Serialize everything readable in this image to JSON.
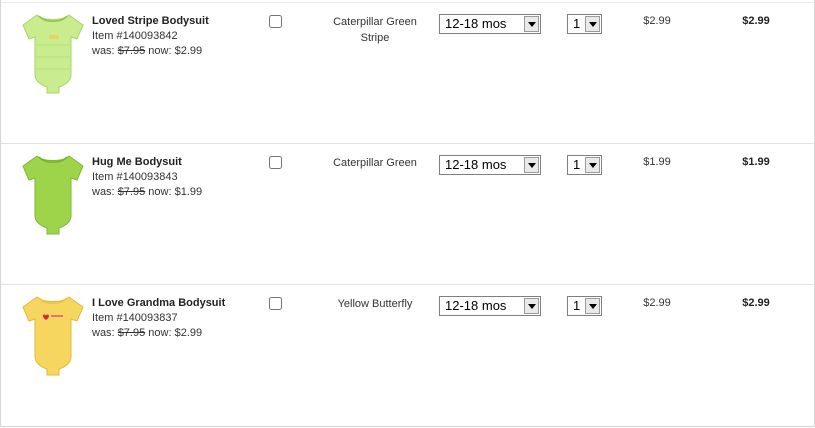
{
  "colors": {
    "green_light": "#c9ec8e",
    "green": "#9ed449",
    "yellow": "#f6d65e"
  },
  "items": [
    {
      "name": "Loved Stripe Bodysuit",
      "item_label": "Item #140093842",
      "was_label": "was:",
      "was_price": "$7.95",
      "now_label": "now:",
      "now_price": "$2.99",
      "color_line1": "Caterpillar Green",
      "color_line2": "Stripe",
      "size": "12-18 mos",
      "qty": "1",
      "price": "$2.99",
      "total": "$2.99"
    },
    {
      "name": "Hug Me Bodysuit",
      "item_label": "Item #140093843",
      "was_label": "was:",
      "was_price": "$7.95",
      "now_label": "now:",
      "now_price": "$1.99",
      "color_line1": "Caterpillar Green",
      "color_line2": "",
      "size": "12-18 mos",
      "qty": "1",
      "price": "$1.99",
      "total": "$1.99"
    },
    {
      "name": "I Love Grandma Bodysuit",
      "item_label": "Item #140093837",
      "was_label": "was:",
      "was_price": "$7.95",
      "now_label": "now:",
      "now_price": "$2.99",
      "color_line1": "Yellow Butterfly",
      "color_line2": "",
      "size": "12-18 mos",
      "qty": "1",
      "price": "$2.99",
      "total": "$2.99"
    }
  ]
}
